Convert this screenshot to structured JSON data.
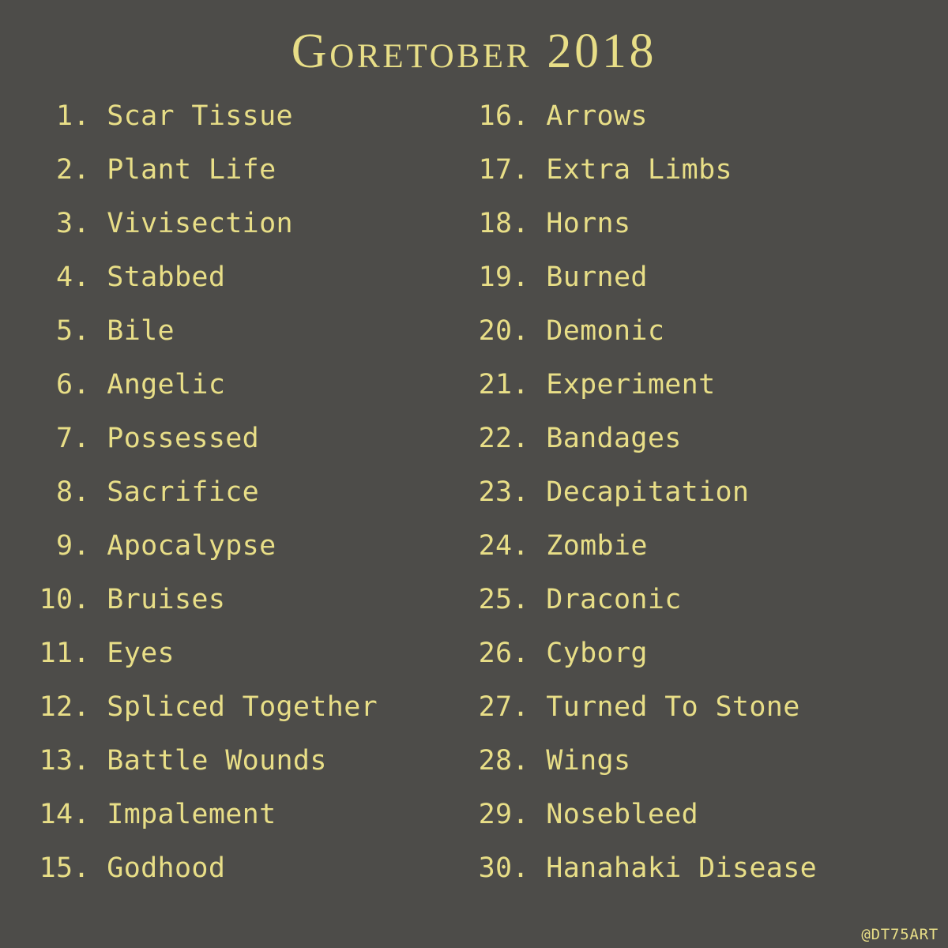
{
  "title": "Goretober 2018",
  "credit": "@DT75ART",
  "columns": [
    [
      {
        "n": "1",
        "label": "Scar Tissue"
      },
      {
        "n": "2",
        "label": "Plant Life"
      },
      {
        "n": "3",
        "label": "Vivisection"
      },
      {
        "n": "4",
        "label": "Stabbed"
      },
      {
        "n": "5",
        "label": "Bile"
      },
      {
        "n": "6",
        "label": "Angelic"
      },
      {
        "n": "7",
        "label": "Possessed"
      },
      {
        "n": "8",
        "label": "Sacrifice"
      },
      {
        "n": "9",
        "label": "Apocalypse"
      },
      {
        "n": "10",
        "label": "Bruises"
      },
      {
        "n": "11",
        "label": "Eyes"
      },
      {
        "n": "12",
        "label": "Spliced Together"
      },
      {
        "n": "13",
        "label": "Battle Wounds"
      },
      {
        "n": "14",
        "label": "Impalement"
      },
      {
        "n": "15",
        "label": "Godhood"
      }
    ],
    [
      {
        "n": "16",
        "label": "Arrows"
      },
      {
        "n": "17",
        "label": "Extra Limbs"
      },
      {
        "n": "18",
        "label": "Horns"
      },
      {
        "n": "19",
        "label": "Burned"
      },
      {
        "n": "20",
        "label": "Demonic"
      },
      {
        "n": "21",
        "label": "Experiment"
      },
      {
        "n": "22",
        "label": "Bandages"
      },
      {
        "n": "23",
        "label": "Decapitation"
      },
      {
        "n": "24",
        "label": "Zombie"
      },
      {
        "n": "25",
        "label": "Draconic"
      },
      {
        "n": "26",
        "label": "Cyborg"
      },
      {
        "n": "27",
        "label": "Turned To Stone"
      },
      {
        "n": "28",
        "label": "Wings"
      },
      {
        "n": "29",
        "label": "Nosebleed"
      },
      {
        "n": "30",
        "label": "Hanahaki Disease"
      }
    ]
  ]
}
